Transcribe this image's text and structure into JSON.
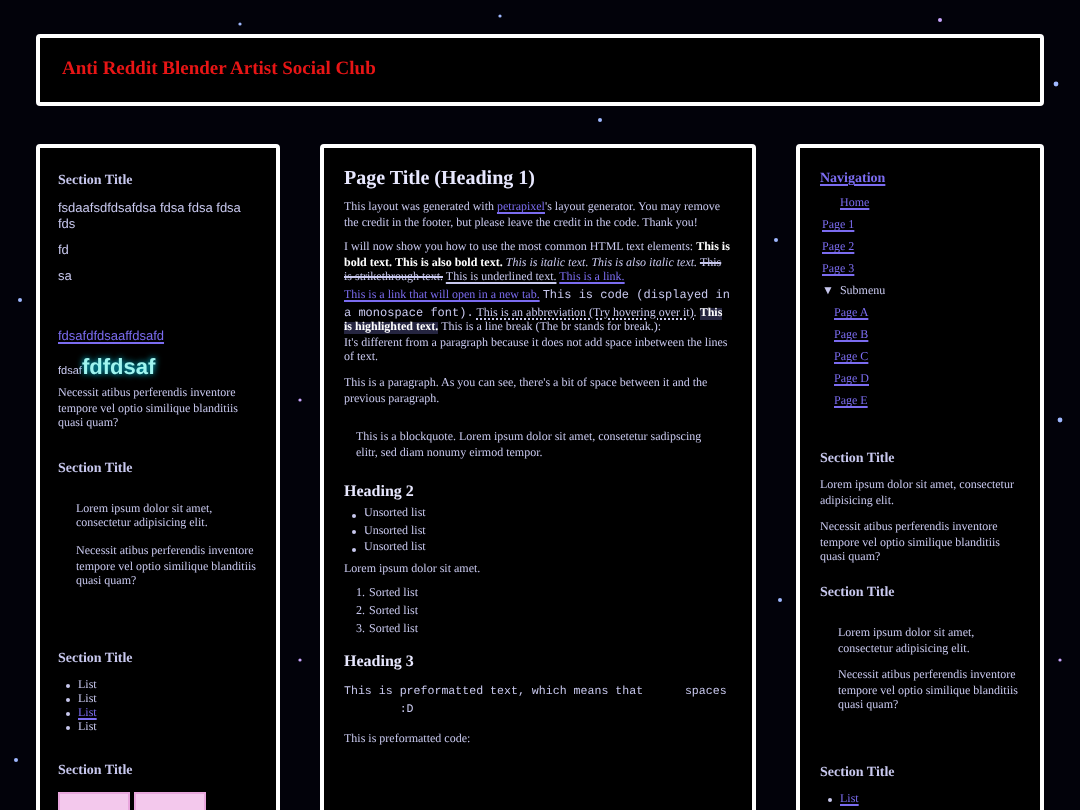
{
  "header": {
    "title": "Anti Reddit Blender Artist Social Club"
  },
  "left": {
    "sections": [
      {
        "title": "Section Title",
        "blocks": [
          {
            "kind": "sans",
            "text": "fsdaafsdfdsafdsa  fdsa fdsa fdsa fds"
          },
          {
            "kind": "sans",
            "text": "fd"
          },
          {
            "kind": "sans",
            "text": "sa"
          },
          {
            "kind": "link",
            "text": "fdsafdfdsaaffdsafd"
          },
          {
            "kind": "glow",
            "small": "fdsaf",
            "big": "fdfdsaf"
          },
          {
            "kind": "para",
            "text": "Necessit atibus perferendis inventore tempore vel optio similique blanditiis quasi quam?"
          }
        ]
      },
      {
        "title": "Section Title",
        "blocks": [
          {
            "kind": "quote",
            "paras": [
              "Lorem ipsum dolor sit amet, consectetur adipisicing elit.",
              "Necessit atibus perferendis inventore tempore vel optio similique blanditiis quasi quam?"
            ]
          }
        ]
      },
      {
        "title": "Section Title",
        "blocks": [
          {
            "kind": "list",
            "items": [
              {
                "text": "List",
                "link": false
              },
              {
                "text": "List",
                "link": false
              },
              {
                "text": "List",
                "link": true
              },
              {
                "text": "List",
                "link": false
              }
            ]
          }
        ]
      },
      {
        "title": "Section Title",
        "blocks": [
          {
            "kind": "badges"
          }
        ]
      }
    ]
  },
  "main": {
    "title": "Page Title (Heading 1)",
    "intro": [
      {
        "kind": "text",
        "text": "This layout was generated with "
      },
      {
        "kind": "link",
        "text": "petrapixel"
      },
      {
        "kind": "text",
        "text": "'s layout generator. You may remove the credit in the footer, but please leave the credit in the code. Thank you!"
      }
    ],
    "elements": [
      {
        "kind": "text",
        "text": "I will now show you how to use the most common HTML text elements:"
      },
      {
        "kind": "bold",
        "text": "This is bold text."
      },
      {
        "kind": "bold",
        "text": "This is also bold text."
      },
      {
        "kind": "italic",
        "text": "This is italic text."
      },
      {
        "kind": "italic",
        "text": "This is also italic text."
      },
      {
        "kind": "strike",
        "text": "This is strikethrough text."
      },
      {
        "kind": "underline",
        "text": "This is underlined text."
      },
      {
        "kind": "link",
        "text": "This is a link."
      },
      {
        "kind": "link",
        "text": "This is a link that will open in a new tab."
      },
      {
        "kind": "code",
        "text": "This is code (displayed in a monospace font)."
      },
      {
        "kind": "abbr",
        "text": "This is an abbreviation (Try hovering over it)."
      },
      {
        "kind": "mark",
        "text": "This is highlighted text."
      },
      {
        "kind": "text",
        "text": "This is a line break (The br stands for break.):"
      },
      {
        "kind": "break",
        "text": "It's different from a paragraph because it does not add space inbetween the lines of text."
      }
    ],
    "paragraph": "This is a paragraph. As you can see, there's a bit of space between it and the previous paragraph.",
    "blockquote": "This is a blockquote. Lorem ipsum dolor sit amet, consetetur sadipscing elitr, sed diam nonumy eirmod tempor.",
    "heading2": "Heading 2",
    "unordered": [
      "Unsorted list",
      "Unsorted list",
      "Unsorted list"
    ],
    "lorem": "Lorem ipsum dolor sit amet.",
    "ordered": [
      {
        "number": "1.",
        "text": "Sorted list"
      },
      {
        "number": "2.",
        "text": "Sorted list"
      },
      {
        "number": "3.",
        "text": "Sorted list"
      }
    ],
    "heading3": "Heading 3",
    "pre": "This is preformatted text, which means that      spaces\n        :D",
    "code_label": "This is preformatted code:"
  },
  "right": {
    "nav": {
      "title": "Navigation",
      "items": [
        {
          "kind": "indented",
          "text": "Home"
        },
        {
          "kind": "link",
          "text": "Page 1"
        },
        {
          "kind": "link",
          "text": "Page 2"
        },
        {
          "kind": "link",
          "text": "Page 3"
        },
        {
          "kind": "submenu",
          "text": "Submenu",
          "marker": "▼",
          "expanded": true,
          "children": [
            {
              "text": "Page A"
            },
            {
              "text": "Page B"
            },
            {
              "text": "Page C"
            },
            {
              "text": "Page D"
            },
            {
              "text": "Page E"
            }
          ]
        }
      ]
    },
    "sections": [
      {
        "title": "Section Title",
        "blocks": [
          {
            "kind": "para",
            "text": "Lorem ipsum dolor sit amet, consectetur adipisicing elit."
          },
          {
            "kind": "para",
            "text": "Necessit atibus perferendis inventore tempore vel optio similique blanditiis quasi quam?"
          }
        ]
      },
      {
        "title": "Section Title",
        "blocks": [
          {
            "kind": "quote",
            "paras": [
              "Lorem ipsum dolor sit amet, consectetur adipisicing elit.",
              "Necessit atibus perferendis inventore tempore vel optio similique blanditiis quasi quam?"
            ]
          }
        ]
      },
      {
        "title": "Section Title",
        "blocks": [
          {
            "kind": "list",
            "items": [
              {
                "text": "List",
                "link": true
              }
            ]
          }
        ]
      }
    ]
  }
}
